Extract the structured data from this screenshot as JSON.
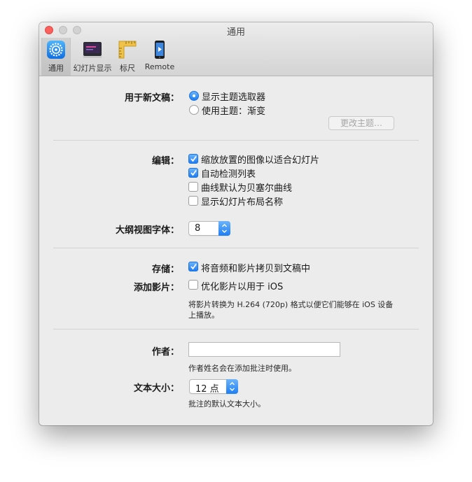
{
  "window": {
    "title": "通用"
  },
  "toolbar": {
    "items": [
      {
        "label": "通用",
        "icon": "general-gear-icon",
        "selected": true
      },
      {
        "label": "幻灯片显示",
        "icon": "slideshow-icon",
        "selected": false
      },
      {
        "label": "标尺",
        "icon": "ruler-icon",
        "selected": false
      },
      {
        "label": "Remote",
        "icon": "remote-iphone-icon",
        "selected": false
      }
    ]
  },
  "new_doc": {
    "label": "用于新文稿：",
    "options": [
      {
        "label": "显示主题选取器",
        "selected": true
      },
      {
        "label": "使用主题：渐变",
        "selected": false
      }
    ],
    "change_theme_button": "更改主题…"
  },
  "editing": {
    "label": "编辑：",
    "options": [
      {
        "label": "缩放放置的图像以适合幻灯片",
        "checked": true
      },
      {
        "label": "自动检测列表",
        "checked": true
      },
      {
        "label": "曲线默认为贝塞尔曲线",
        "checked": false
      },
      {
        "label": "显示幻灯片布局名称",
        "checked": false
      }
    ]
  },
  "outline_font": {
    "label": "大纲视图字体：",
    "value": "8"
  },
  "storage": {
    "label": "存储：",
    "option": "将音频和影片拷贝到文稿中",
    "checked": true
  },
  "add_movie": {
    "label": "添加影片：",
    "option": "优化影片以用于 iOS",
    "checked": false,
    "help_line1": "将影片转换为 H.264 (720p) 格式以便它们能够在 iOS 设备",
    "help_line2": "上播放。"
  },
  "author": {
    "label": "作者：",
    "value": "",
    "help": "作者姓名会在添加批注时使用。"
  },
  "text_size": {
    "label": "文本大小：",
    "value": "12 点",
    "help": "批注的默认文本大小。"
  },
  "colors": {
    "accent": "#1d7ef4",
    "close": "#fc605c"
  }
}
